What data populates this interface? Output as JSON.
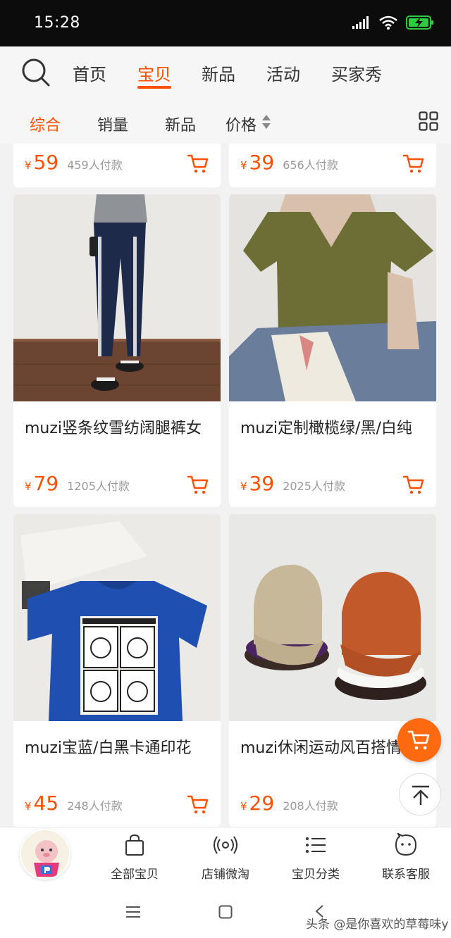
{
  "status_bar": {
    "time": "15:28"
  },
  "top_nav": {
    "tabs": [
      {
        "label": "首页"
      },
      {
        "label": "宝贝"
      },
      {
        "label": "新品"
      },
      {
        "label": "活动"
      },
      {
        "label": "买家秀"
      }
    ],
    "active_tab": "宝贝"
  },
  "sort_bar": {
    "items": [
      {
        "label": "综合"
      },
      {
        "label": "销量"
      },
      {
        "label": "新品"
      },
      {
        "label": "价格"
      }
    ],
    "active": "综合"
  },
  "products": [
    {
      "title": "",
      "price": "59",
      "sold": "459人付款",
      "currency": "¥"
    },
    {
      "title": "",
      "price": "39",
      "sold": "656人付款",
      "currency": "¥"
    },
    {
      "title": "muzi竖条纹雪纺阔腿裤女",
      "price": "79",
      "sold": "1205人付款",
      "currency": "¥"
    },
    {
      "title": "muzi定制橄榄绿/黑/白纯",
      "price": "39",
      "sold": "2025人付款",
      "currency": "¥"
    },
    {
      "title": "muzi宝蓝/白黑卡通印花",
      "price": "45",
      "sold": "248人付款",
      "currency": "¥"
    },
    {
      "title": "muzi休闲运动风百搭情",
      "price": "29",
      "sold": "208人付款",
      "currency": "¥"
    }
  ],
  "bottom_bar": {
    "items": [
      {
        "label": "全部宝贝",
        "icon": "bag-icon"
      },
      {
        "label": "店铺微淘",
        "icon": "broadcast-icon"
      },
      {
        "label": "宝贝分类",
        "icon": "category-list-icon"
      },
      {
        "label": "联系客服",
        "icon": "chat-face-icon"
      }
    ]
  },
  "watermark": "头条 @是你喜欢的草莓味y",
  "colors": {
    "accent": "#ff5000",
    "status_bar": "#0c0c0c",
    "battery": "#2ecc40"
  }
}
